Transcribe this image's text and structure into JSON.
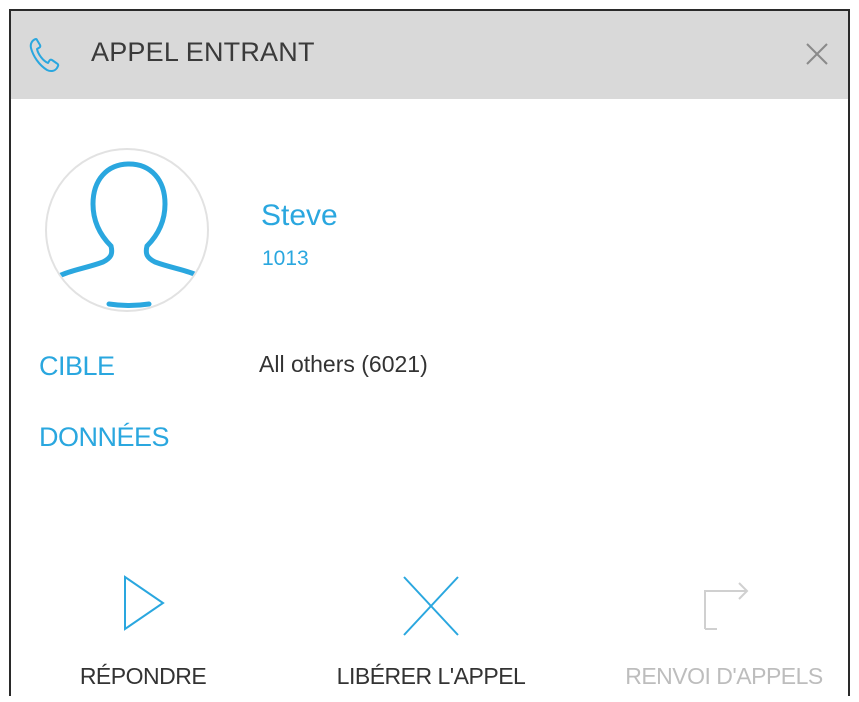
{
  "header": {
    "icon": "phone-icon",
    "title": "APPEL ENTRANT",
    "close_icon": "close-icon"
  },
  "caller": {
    "avatar_icon": "user-silhouette-icon",
    "name": "Steve",
    "number": "1013"
  },
  "details": {
    "target_label": "CIBLE",
    "target_value": "All others (6021)",
    "data_label": "DONNÉES"
  },
  "actions": [
    {
      "label": "RÉPONDRE",
      "icon": "play-icon",
      "enabled": true
    },
    {
      "label": "LIBÉRER L'APPEL",
      "icon": "close-x-icon",
      "enabled": true
    },
    {
      "label": "RENVOI D'APPELS",
      "icon": "forward-arrow-icon",
      "enabled": false
    }
  ],
  "colors": {
    "accent": "#2aa7df",
    "titlebar": "#d9d9d9",
    "text": "#333333",
    "disabled": "#bdbdbd"
  }
}
